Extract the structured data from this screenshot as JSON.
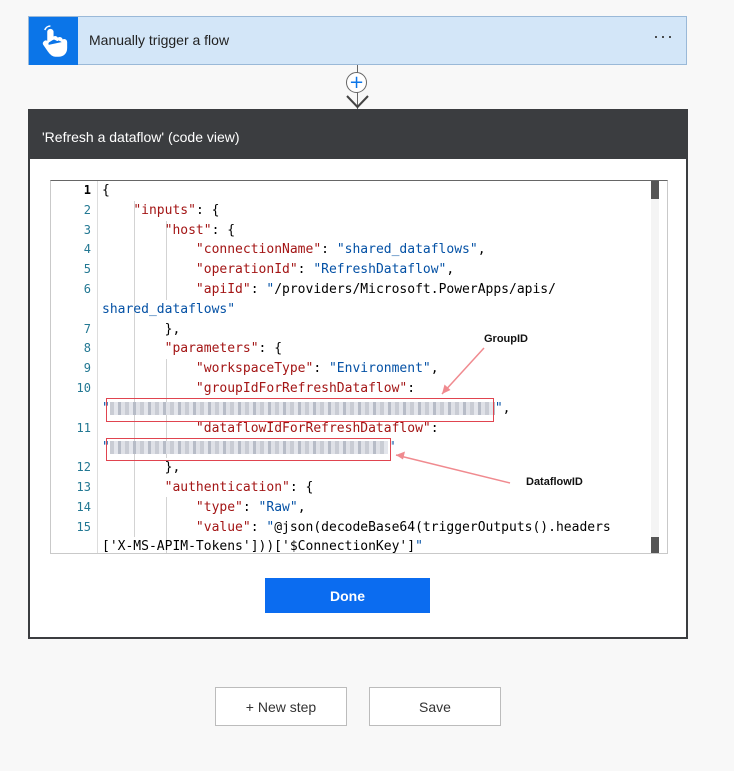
{
  "trigger": {
    "title": "Manually trigger a flow",
    "more_label": "···",
    "icon": "hand-tap-icon"
  },
  "connector": {
    "add_label": "+"
  },
  "action_card": {
    "title": "'Refresh a dataflow' (code view)",
    "done_label": "Done",
    "code_lines": [
      {
        "n": "1",
        "text": "{"
      },
      {
        "n": "2",
        "text": "    \"inputs\": {"
      },
      {
        "n": "3",
        "text": "        \"host\": {"
      },
      {
        "n": "4",
        "text": "            \"connectionName\": \"shared_dataflows\","
      },
      {
        "n": "5",
        "text": "            \"operationId\": \"RefreshDataflow\","
      },
      {
        "n": "6",
        "text": "            \"apiId\": \"/providers/Microsoft.PowerApps/apis/"
      },
      {
        "n": "",
        "text": "shared_dataflows\""
      },
      {
        "n": "7",
        "text": "        },"
      },
      {
        "n": "8",
        "text": "        \"parameters\": {"
      },
      {
        "n": "9",
        "text": "            \"workspaceType\": \"Environment\","
      },
      {
        "n": "10",
        "text": "            \"groupIdForRefreshDataflow\":"
      },
      {
        "n": "",
        "text": "\""
      },
      {
        "n": "11",
        "text": "            \"dataflowIdForRefreshDataflow\":"
      },
      {
        "n": "",
        "text": "\""
      },
      {
        "n": "12",
        "text": "        },"
      },
      {
        "n": "13",
        "text": "        \"authentication\": {"
      },
      {
        "n": "14",
        "text": "            \"type\": \"Raw\","
      },
      {
        "n": "15",
        "text": "            \"value\": \"@json(decodeBase64(triggerOutputs().headers"
      },
      {
        "n": "",
        "text": "['X-MS-APIM-Tokens']))['$ConnectionKey']\""
      }
    ]
  },
  "annotations": {
    "group": "GroupID",
    "dataflow": "DataflowID",
    "color": "#f08a8f"
  },
  "footer": {
    "new_step_label": "+ New step",
    "save_label": "Save"
  },
  "colors": {
    "accent": "#0b6cf0",
    "trigger_bg": "#d3e6f8",
    "header_bg": "#3b3d40"
  }
}
